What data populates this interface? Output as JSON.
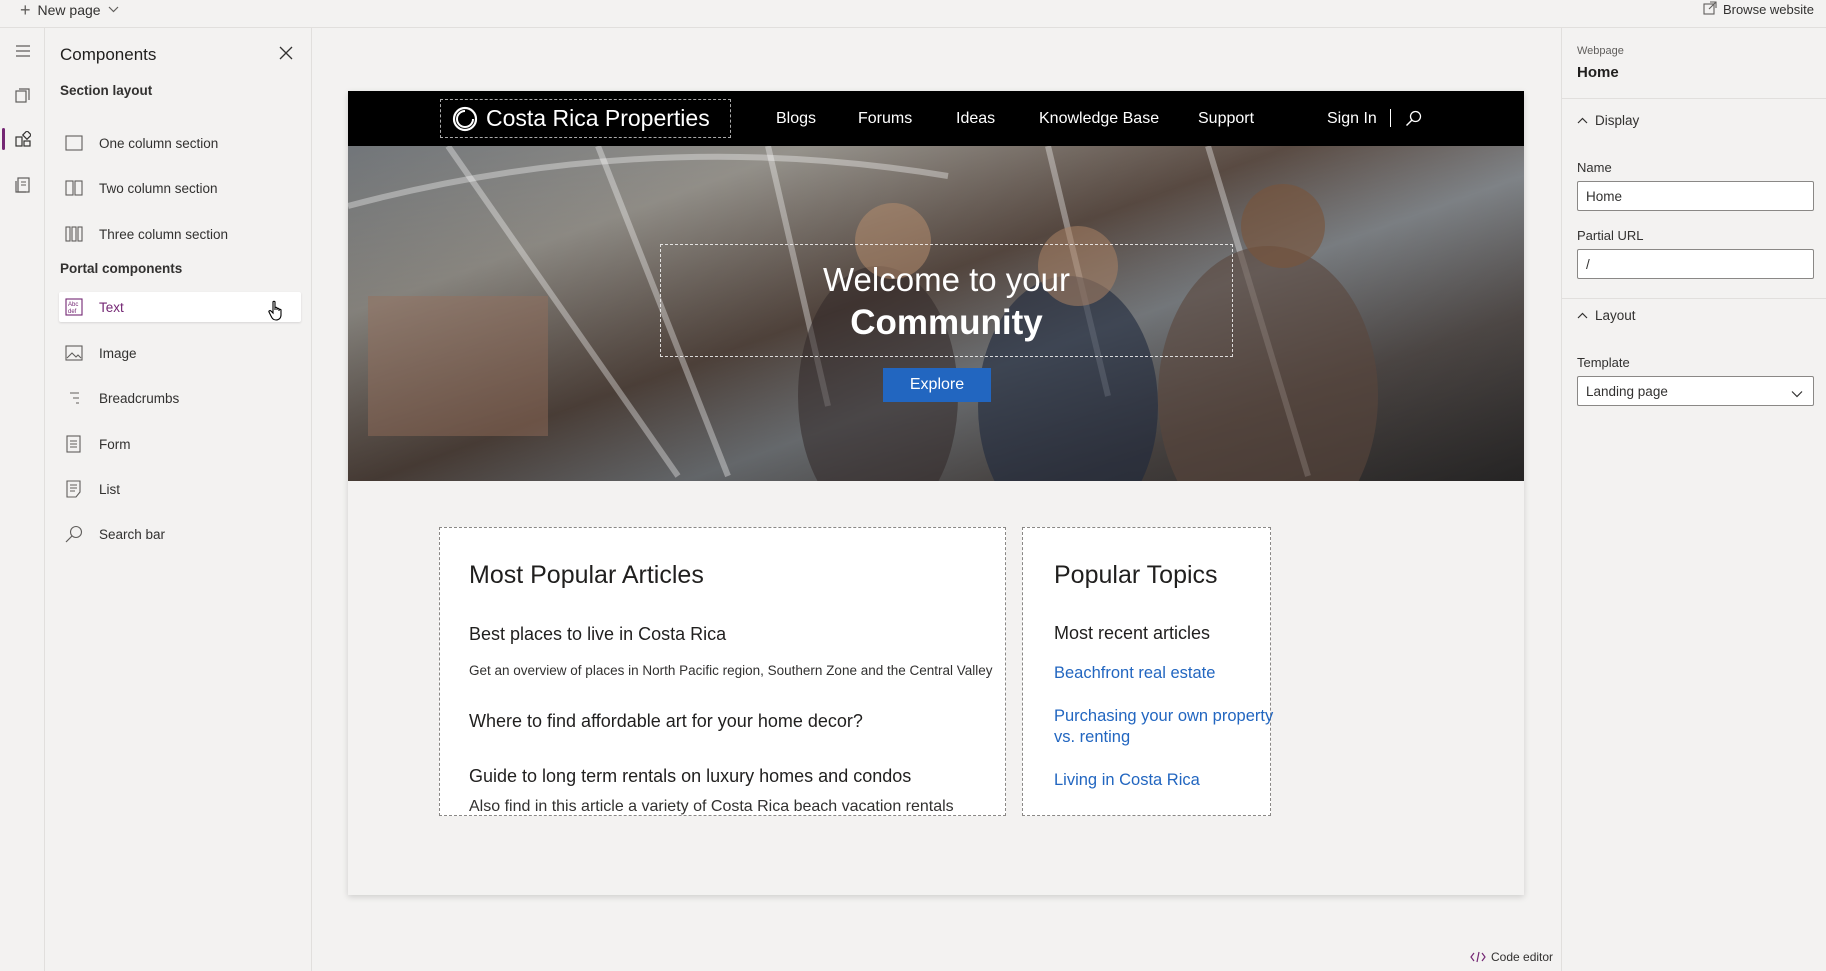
{
  "topbar": {
    "new_page_label": "New page",
    "browse_label": "Browse website"
  },
  "rail": {
    "items": [
      "menu-icon",
      "pages-icon",
      "components-icon",
      "templates-icon"
    ]
  },
  "components_panel": {
    "title": "Components",
    "section_layout_label": "Section layout",
    "section_layouts": [
      {
        "label": "One column section",
        "icon": "one-column-icon"
      },
      {
        "label": "Two column section",
        "icon": "two-column-icon"
      },
      {
        "label": "Three column section",
        "icon": "three-column-icon"
      }
    ],
    "portal_components_label": "Portal components",
    "portal_components": [
      {
        "label": "Text",
        "icon": "text-icon"
      },
      {
        "label": "Image",
        "icon": "image-icon"
      },
      {
        "label": "Breadcrumbs",
        "icon": "breadcrumbs-icon"
      },
      {
        "label": "Form",
        "icon": "form-icon"
      },
      {
        "label": "List",
        "icon": "list-icon"
      },
      {
        "label": "Search bar",
        "icon": "search-icon"
      }
    ]
  },
  "site": {
    "brand": "Costa Rica Properties",
    "nav": [
      "Blogs",
      "Forums",
      "Ideas",
      "Knowledge Base",
      "Support"
    ],
    "sign_in": "Sign In",
    "hero": {
      "line1": "Welcome to your",
      "line2": "Community",
      "button": "Explore"
    },
    "articles": {
      "title": "Most Popular Articles",
      "items": [
        {
          "title": "Best places to live in Costa Rica",
          "desc": "Get an overview of places in North Pacific region, Southern Zone and the Central Valley"
        },
        {
          "title": "Where to find affordable art for your home decor?",
          "desc": ""
        },
        {
          "title": "Guide to long term rentals on luxury homes and condos",
          "desc": "Also find in this article  a variety of Costa Rica beach vacation rentals"
        }
      ]
    },
    "topics": {
      "title": "Popular Topics",
      "subtitle": "Most recent articles",
      "links": [
        "Beachfront real estate",
        "Purchasing your own property vs. renting",
        "Living in Costa Rica"
      ]
    }
  },
  "code_editor_label": "Code editor",
  "properties": {
    "kind": "Webpage",
    "name": "Home",
    "display_group": "Display",
    "name_label": "Name",
    "name_value": "Home",
    "url_label": "Partial URL",
    "url_value": "/",
    "layout_group": "Layout",
    "template_label": "Template",
    "template_value": "Landing page"
  },
  "colors": {
    "accent": "#742774",
    "link": "#2266c0",
    "nav_bg": "#000000"
  }
}
